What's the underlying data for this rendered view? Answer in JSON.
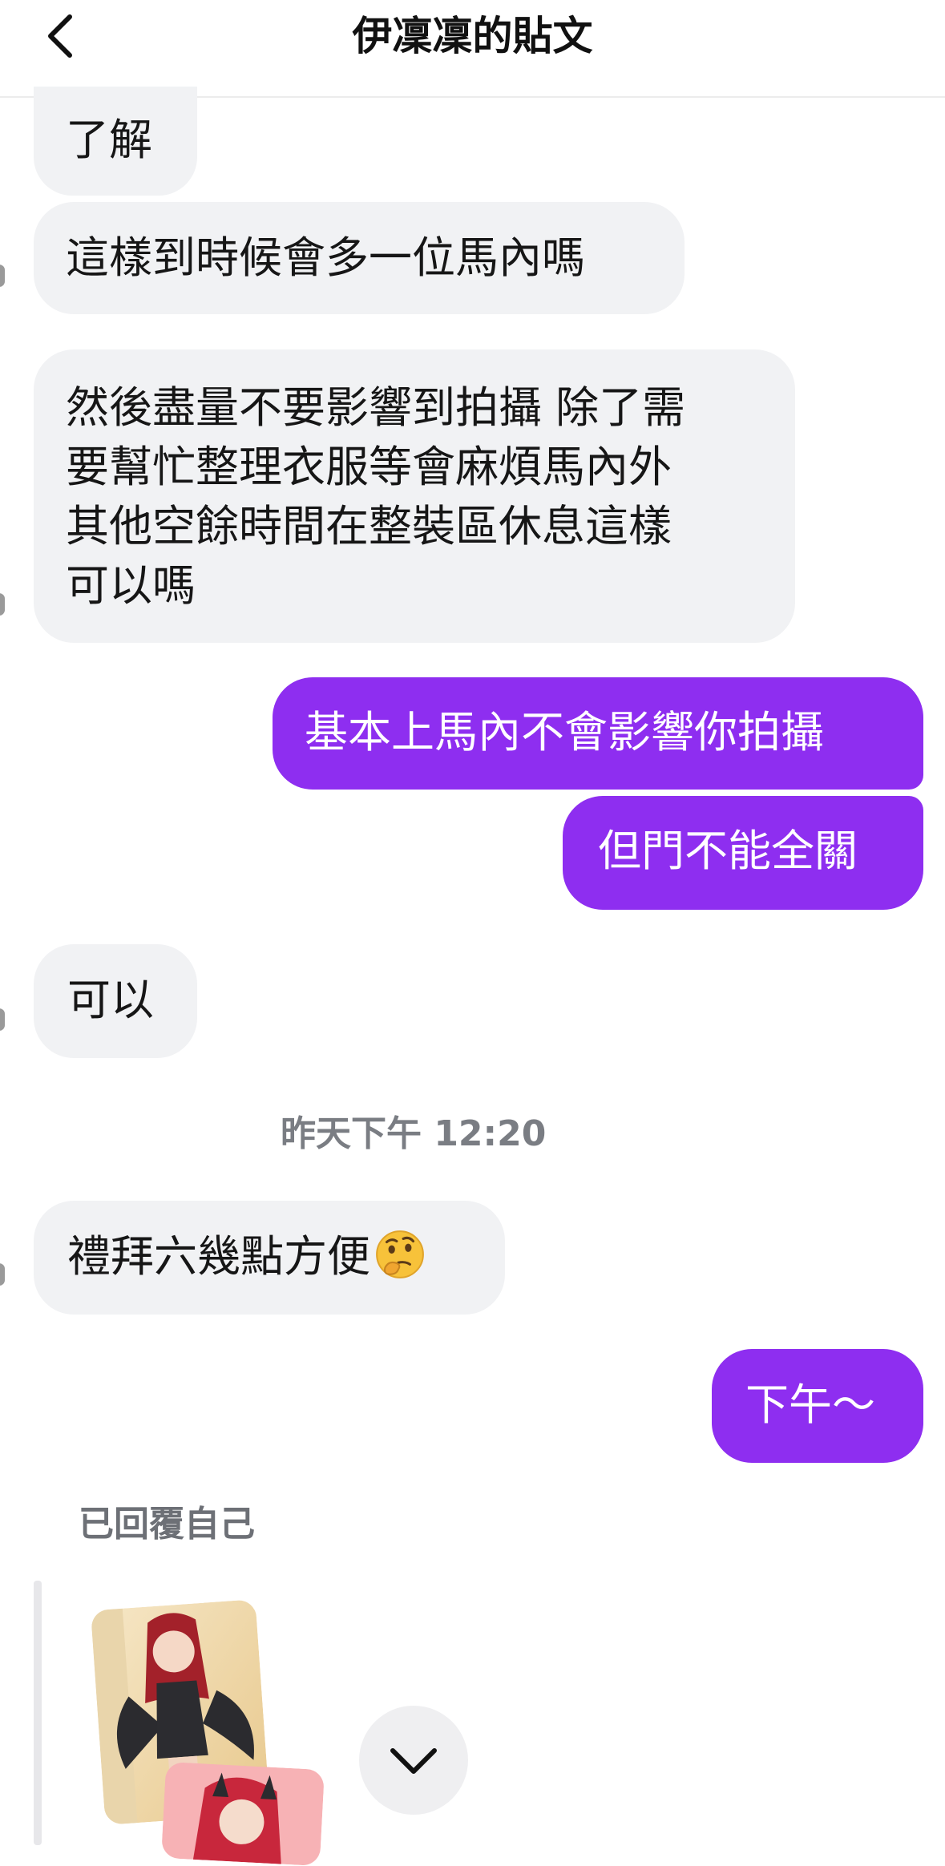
{
  "header": {
    "title": "伊凜凜的貼文",
    "back_icon": "chevron-left-icon"
  },
  "messages": [
    {
      "side": "in",
      "text": "了解"
    },
    {
      "side": "in",
      "text": "這樣到時候會多一位馬內嗎"
    },
    {
      "side": "in",
      "lines": [
        "然後盡量不要影響到拍攝 除了需",
        "要幫忙整理衣服等會麻煩馬內外",
        "其他空餘時間在整裝區休息這樣",
        "可以嗎"
      ]
    },
    {
      "side": "out",
      "text": "基本上馬內不會影響你拍攝"
    },
    {
      "side": "out",
      "text": "但門不能全關"
    },
    {
      "side": "in",
      "text": "可以"
    },
    {
      "side": "in",
      "text": "禮拜六幾點方便",
      "emoji": "thinking-face-emoji"
    },
    {
      "side": "out",
      "text": "下午～"
    }
  ],
  "timestamp": "昨天下午 12:20",
  "reply": {
    "label": "已回覆自己"
  },
  "colors": {
    "outgoing_bubble": "#8e2ef0",
    "incoming_bubble": "#f1f2f4",
    "timestamp_text": "#7a7d83"
  },
  "scroll_button_icon": "chevron-down-icon"
}
